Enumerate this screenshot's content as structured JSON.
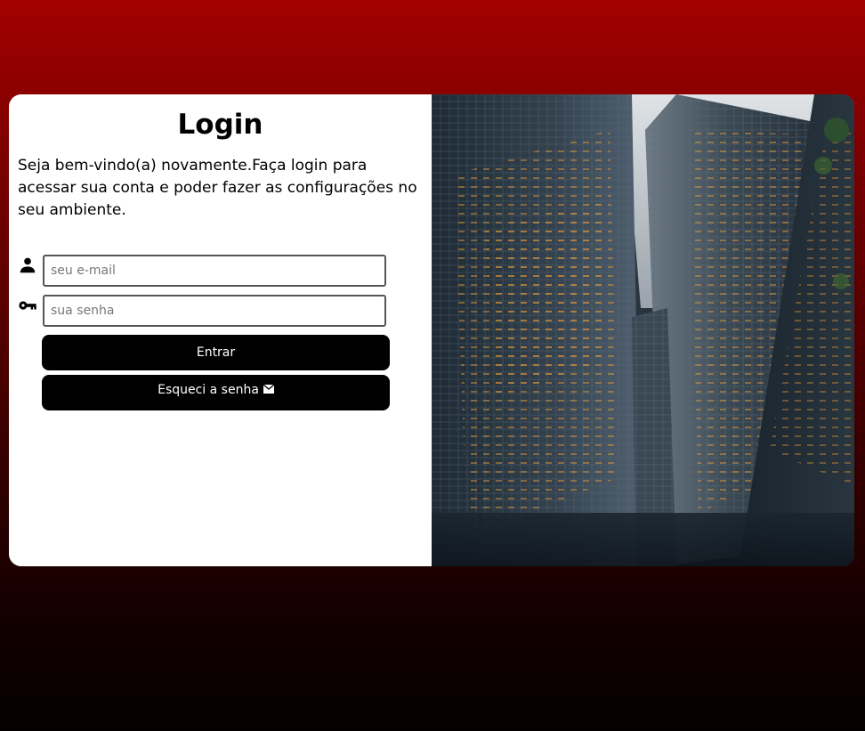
{
  "login": {
    "title": "Login",
    "welcome_text": "Seja bem-vindo(a) novamente.Faça login para acessar sua conta e poder fazer as configurações no seu ambiente.",
    "email": {
      "placeholder": "seu e-mail",
      "value": "",
      "icon": "person-icon"
    },
    "password": {
      "placeholder": "sua senha",
      "value": "",
      "icon": "key-icon"
    },
    "enter_label": "Entrar",
    "forgot_label": "Esqueci a senha",
    "forgot_icon": "mail-icon"
  },
  "colors": {
    "background_top": "#a30000",
    "background_bottom": "#050000",
    "button_bg": "#000000",
    "button_text": "#ffffff",
    "card_bg": "#ffffff"
  },
  "image": {
    "subject": "skyscrapers-photo"
  }
}
